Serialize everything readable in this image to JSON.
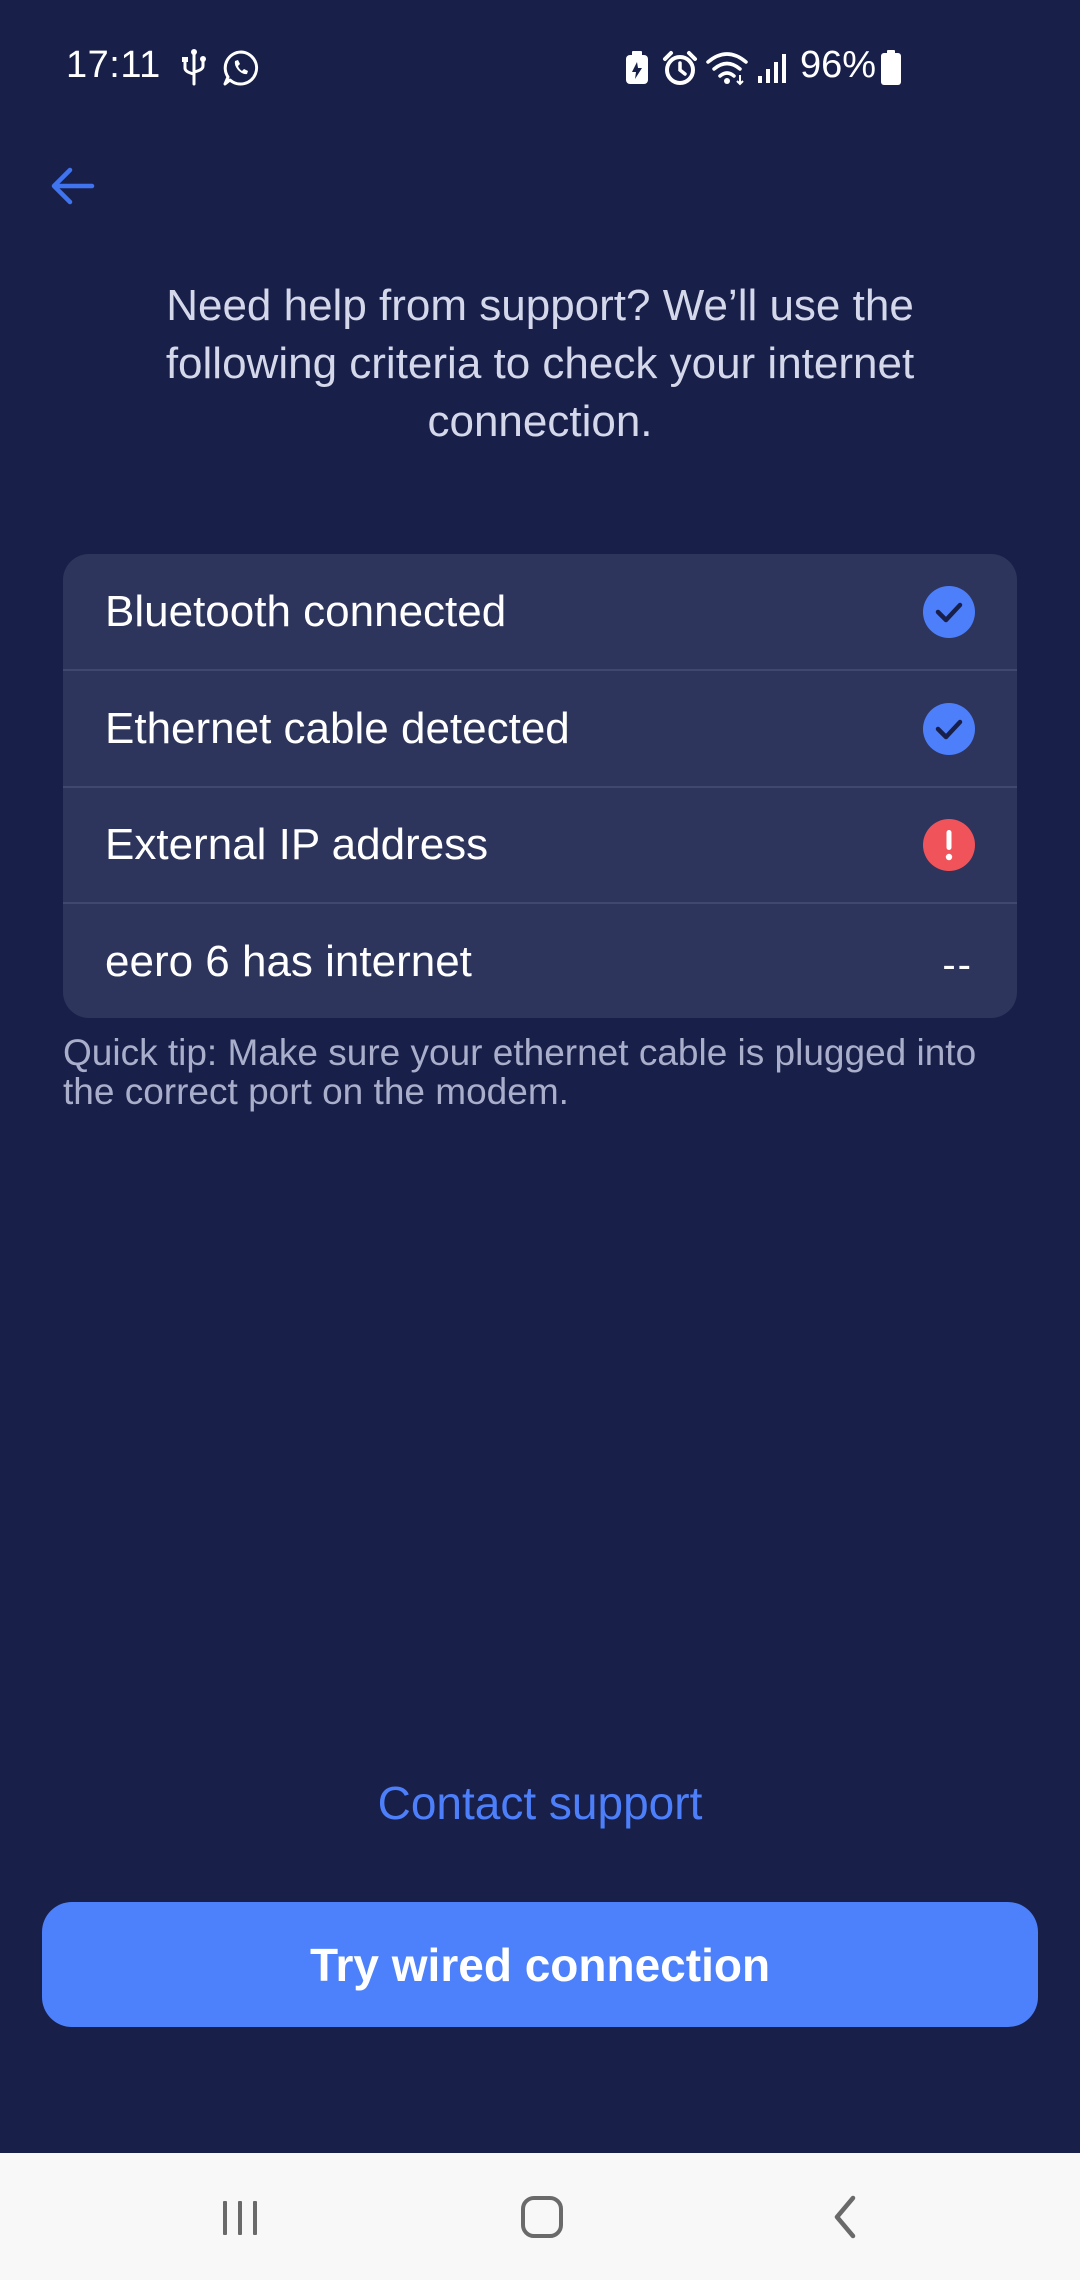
{
  "status_bar": {
    "time": "17:11",
    "battery_percent": "96%",
    "icons": [
      "usb-icon",
      "whatsapp-icon",
      "battery-saver-icon",
      "alarm-icon",
      "wifi-icon",
      "signal-icon",
      "battery-icon"
    ]
  },
  "header": {
    "back_icon": "arrow-left-icon"
  },
  "intro_text": "Need help from support? We’ll use the following criteria to check your internet connection.",
  "checklist": [
    {
      "label": "Bluetooth connected",
      "status": "success",
      "icon": "check-circle-icon"
    },
    {
      "label": "Ethernet cable detected",
      "status": "success",
      "icon": "check-circle-icon"
    },
    {
      "label": "External IP address",
      "status": "error",
      "icon": "exclamation-circle-icon"
    },
    {
      "label": "eero 6 has internet",
      "status": "pending",
      "value": "--"
    }
  ],
  "tip": "Quick tip: Make sure your ethernet cable is plugged into the correct port on the modem.",
  "actions": {
    "contact_support": "Contact support",
    "try_wired": "Try wired connection"
  },
  "nav_bar": {
    "icons": [
      "recent-apps-icon",
      "home-icon",
      "back-nav-icon"
    ]
  },
  "colors": {
    "background": "#18204a",
    "card": "#2e355c",
    "accent": "#4d80fb",
    "success": "#4d7ffb",
    "error": "#f0535a",
    "nav_bar": "#f8f8f8"
  }
}
